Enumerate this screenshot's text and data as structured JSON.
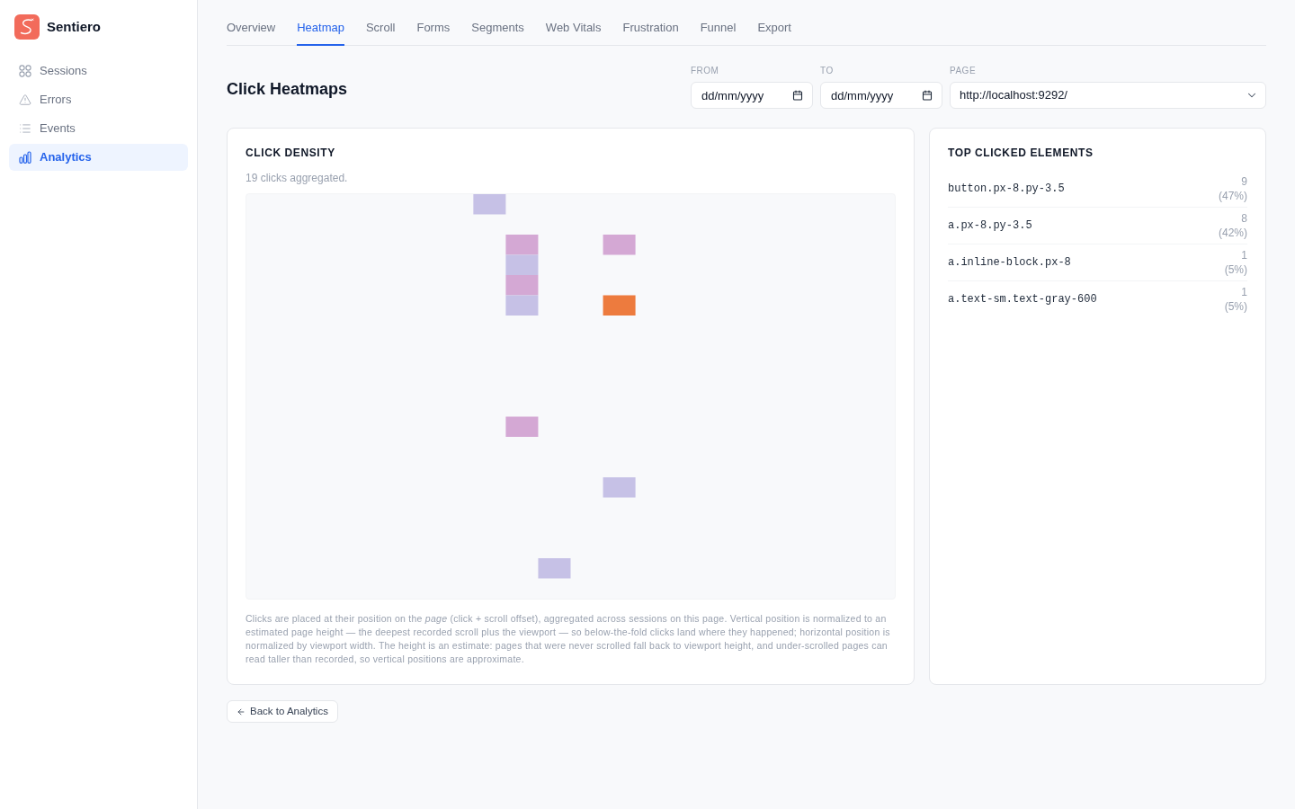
{
  "sidebar": {
    "brand": "Sentiero",
    "items": [
      {
        "label": "Sessions",
        "selected": false
      },
      {
        "label": "Errors",
        "selected": false
      },
      {
        "label": "Events",
        "selected": false
      },
      {
        "label": "Analytics",
        "selected": true
      }
    ]
  },
  "tabs": [
    {
      "label": "Overview",
      "selected": false
    },
    {
      "label": "Heatmap",
      "selected": true
    },
    {
      "label": "Scroll",
      "selected": false
    },
    {
      "label": "Forms",
      "selected": false
    },
    {
      "label": "Segments",
      "selected": false
    },
    {
      "label": "Web Vitals",
      "selected": false
    },
    {
      "label": "Frustration",
      "selected": false
    },
    {
      "label": "Funnel",
      "selected": false
    },
    {
      "label": "Export",
      "selected": false
    }
  ],
  "header": {
    "title": "Click Heatmaps",
    "from": {
      "label": "FROM",
      "placeholder": "dd/mm/yyyy"
    },
    "to": {
      "label": "TO",
      "placeholder": "dd/mm/yyyy"
    },
    "page": {
      "label": "PAGE",
      "value": "http://localhost:9292/"
    }
  },
  "click_density": {
    "title": "CLICK DENSITY",
    "summary": "19 clicks aggregated.",
    "caption": "Clicks are placed at their position on the *page* (click + scroll offset), aggregated across sessions on this page. Vertical position is normalized to an estimated page height — the deepest recorded scroll plus the viewport — so below-the-fold clicks land where they happened; horizontal position is normalized by viewport width. The height is an estimate: pages that were never scrolled fall back to viewport height, and under-scrolled pages can read taller than recorded, so vertical positions are approximate."
  },
  "top_clicked": {
    "title": "TOP CLICKED ELEMENTS",
    "rows": [
      {
        "selector": "button.px-8.py-3.5",
        "count": "9",
        "share": "(47%)"
      },
      {
        "selector": "a.px-8.py-3.5",
        "count": "8",
        "share": "(42%)"
      },
      {
        "selector": "a.inline-block.px-8",
        "count": "1",
        "share": "(5%)"
      },
      {
        "selector": "a.text-sm.text-gray-600",
        "count": "1",
        "share": "(5%)"
      }
    ]
  },
  "back_button": {
    "label": "Back to Analytics"
  }
}
